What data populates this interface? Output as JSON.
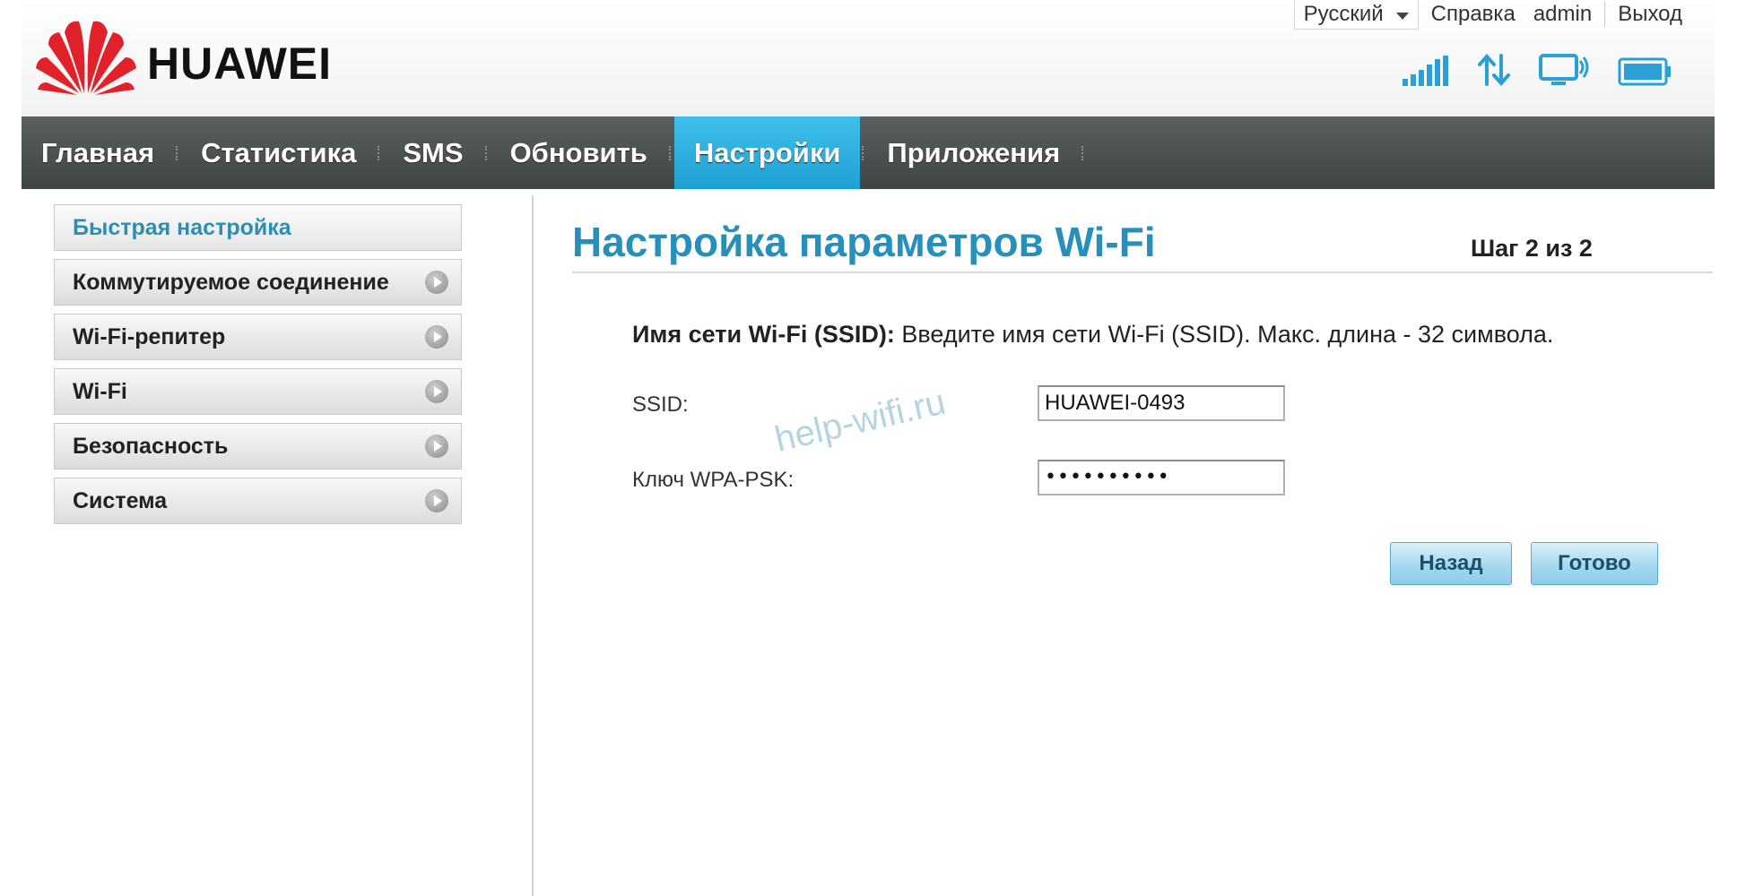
{
  "header": {
    "brand": "HUAWEI",
    "language": "Русский",
    "links": {
      "help": "Справка",
      "user": "admin",
      "logout": "Выход"
    },
    "status_icons": [
      "signal-strength-icon",
      "data-transfer-icon",
      "wifi-display-icon",
      "battery-icon"
    ]
  },
  "nav": {
    "items": [
      {
        "label": "Главная",
        "active": false
      },
      {
        "label": "Статистика",
        "active": false
      },
      {
        "label": "SMS",
        "active": false
      },
      {
        "label": "Обновить",
        "active": false
      },
      {
        "label": "Настройки",
        "active": true
      },
      {
        "label": "Приложения",
        "active": false
      }
    ]
  },
  "sidebar": {
    "items": [
      {
        "label": "Быстрая настройка",
        "active": true
      },
      {
        "label": "Коммутируемое соединение"
      },
      {
        "label": "Wi-Fi-репитер"
      },
      {
        "label": "Wi-Fi"
      },
      {
        "label": "Безопасность"
      },
      {
        "label": "Система"
      }
    ]
  },
  "content": {
    "title": "Настройка параметров Wi-Fi",
    "step": "Шаг 2 из 2",
    "hint_label": "Имя сети Wi-Fi (SSID):",
    "hint_text": " Введите имя сети Wi-Fi (SSID). Макс. длина - 32 символа.",
    "ssid_label": "SSID:",
    "ssid_value": "HUAWEI-0493",
    "key_label": "Ключ WPA-PSK:",
    "key_value": "••••••••••",
    "back_button": "Назад",
    "done_button": "Готово"
  },
  "watermark": "help-wifi.ru",
  "colors": {
    "accent": "#2690bb",
    "nav_bg": "#474c4d",
    "nav_active": "#2aa8db",
    "button_bg": "#a6d8f0"
  }
}
